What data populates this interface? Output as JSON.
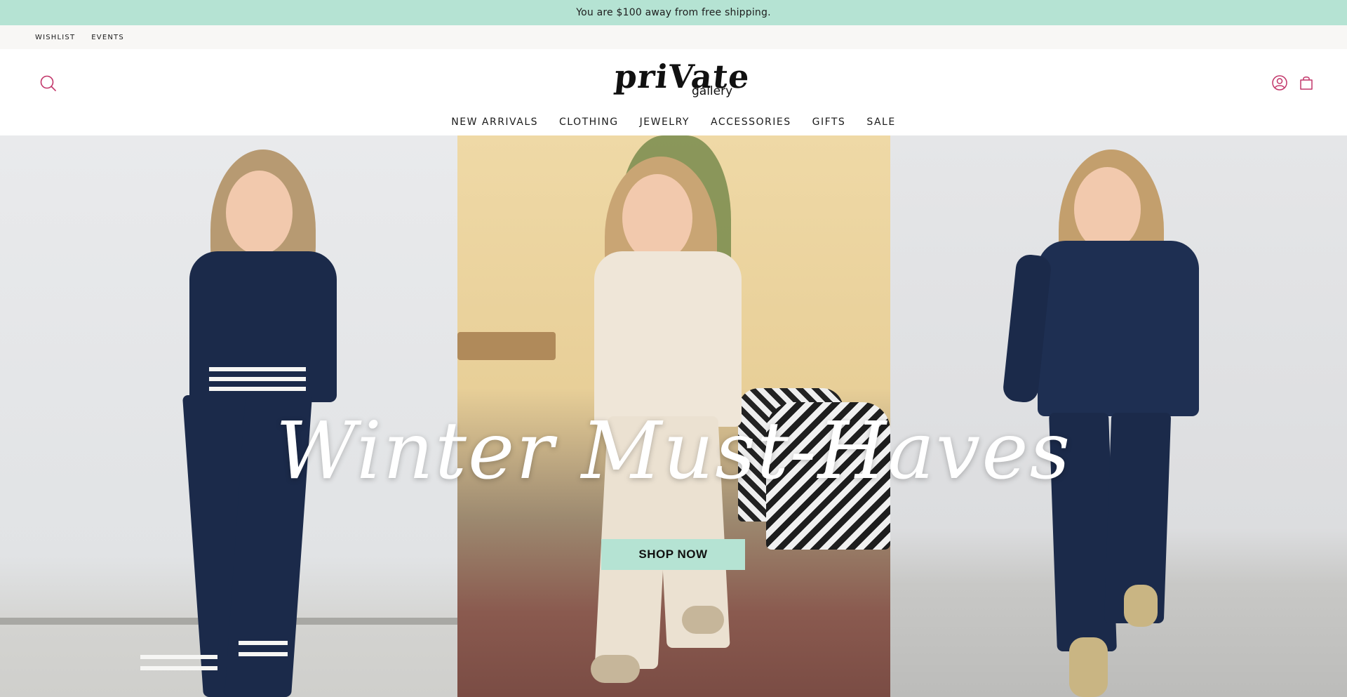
{
  "announcement": {
    "text": "You are $100 away from free shipping."
  },
  "utility_nav": {
    "items": [
      {
        "label": "WISHLIST"
      },
      {
        "label": "EVENTS"
      }
    ]
  },
  "header": {
    "logo": {
      "main": "priVate",
      "sub": "gallery"
    },
    "icons": {
      "search": "search-icon",
      "account": "account-icon",
      "cart": "cart-icon"
    }
  },
  "main_nav": {
    "items": [
      {
        "label": "NEW ARRIVALS"
      },
      {
        "label": "CLOTHING"
      },
      {
        "label": "JEWELRY"
      },
      {
        "label": "ACCESSORIES"
      },
      {
        "label": "GIFTS"
      },
      {
        "label": "SALE"
      }
    ]
  },
  "hero": {
    "title": "Winter Must-Haves",
    "cta_label": "SHOP NOW"
  },
  "colors": {
    "accent": "#b5e3d3",
    "navy": "#1b2a4a",
    "cream": "#efe6d8"
  }
}
